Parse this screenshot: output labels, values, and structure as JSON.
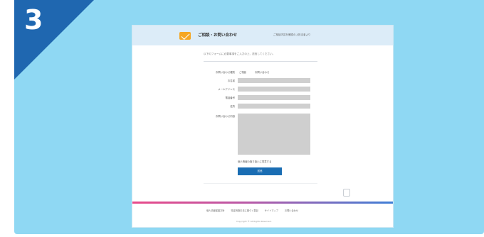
{
  "step": {
    "number": "3",
    "badge_color": "#1f67b0",
    "panel_color": "#8fd8f3"
  },
  "site": {
    "title": "ご相談・お問い合わせ",
    "header_note": "ご相談内容を確認の上担当者より",
    "logo_icon": "mail-icon"
  },
  "form": {
    "intro": "以下のフォームに必要事項をご入力の上、送信してください。",
    "rows": [
      {
        "label": "お問い合わせ種別"
      },
      {
        "label": "お名前"
      },
      {
        "label": "メールアドレス"
      },
      {
        "label": "電話番号"
      },
      {
        "label": "住所"
      },
      {
        "label": "お問い合わせ内容"
      }
    ],
    "type_options": [
      "ご相談",
      "お問い合わせ"
    ],
    "agree_label": "個人情報の取り扱いに同意する",
    "submit_label": "送信",
    "accent_color": "#1a6db3"
  },
  "footer": {
    "links": [
      "個人情報保護方針",
      "特定商取引法に基づく表記",
      "サイトマップ",
      "お問い合わせ"
    ],
    "copyright": "Copyright © All Rights Reserved."
  }
}
